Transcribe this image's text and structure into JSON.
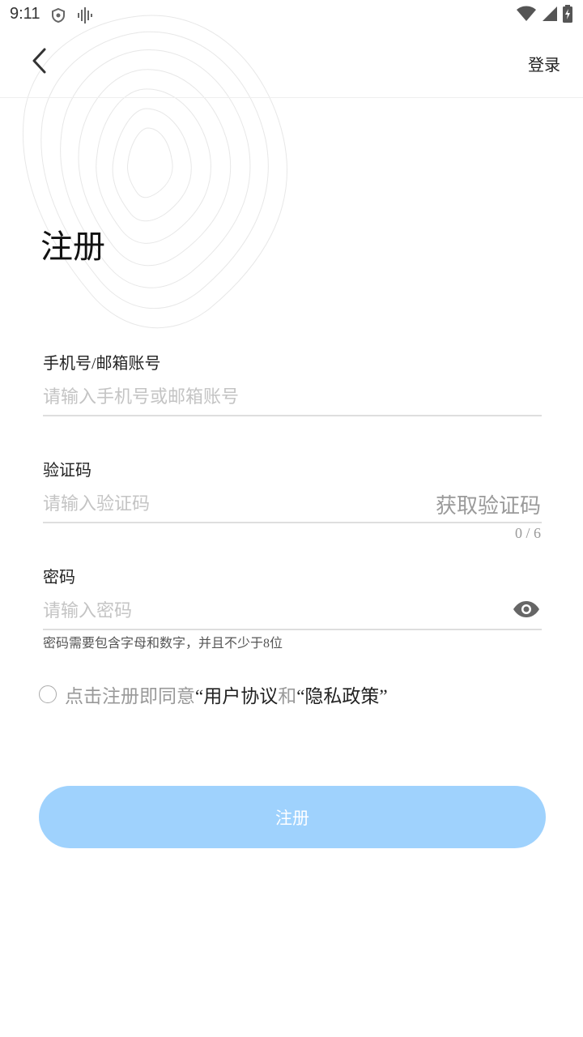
{
  "status_bar": {
    "time": "9:11",
    "left_icons": [
      "shield-icon",
      "voice-wave-icon"
    ],
    "right_icons": [
      "wifi-icon",
      "signal-icon",
      "battery-charging-icon"
    ]
  },
  "header": {
    "back_icon": "chevron-left-icon",
    "login_label": "登录"
  },
  "page": {
    "title": "注册"
  },
  "form": {
    "account": {
      "label": "手机号/邮箱账号",
      "placeholder": "请输入手机号或邮箱账号",
      "value": ""
    },
    "code": {
      "label": "验证码",
      "placeholder": "请输入验证码",
      "value": "",
      "get_code_label": "获取验证码",
      "counter": "0 / 6"
    },
    "password": {
      "label": "密码",
      "placeholder": "请输入密码",
      "value": "",
      "toggle_icon": "eye-icon",
      "hint": "密码需要包含字母和数字，并且不少于8位"
    }
  },
  "agreement": {
    "checked": false,
    "prefix": "点击注册即同意",
    "terms_link": "“用户协议",
    "conjunction": "和",
    "privacy_link": "“隐私政策”"
  },
  "submit": {
    "label": "注册"
  },
  "colors": {
    "primary_button": "#9fd2fd",
    "placeholder": "#c4c4c4",
    "divider": "#dedede"
  }
}
